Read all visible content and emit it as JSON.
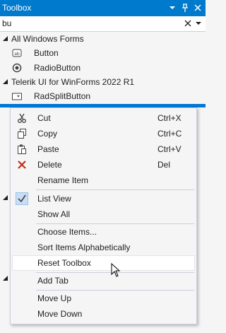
{
  "window": {
    "title": "Toolbox"
  },
  "search": {
    "value": "bu"
  },
  "tree": {
    "groups": [
      {
        "label": "All Windows Forms",
        "items": [
          "Button",
          "RadioButton"
        ]
      },
      {
        "label": "Telerik UI for WinForms 2022 R1",
        "items": [
          "RadSplitButton"
        ]
      }
    ]
  },
  "menu": {
    "items": [
      {
        "label": "Cut",
        "shortcut": "Ctrl+X",
        "icon": "scissors-icon"
      },
      {
        "label": "Copy",
        "shortcut": "Ctrl+C",
        "icon": "copy-icon"
      },
      {
        "label": "Paste",
        "shortcut": "Ctrl+V",
        "icon": "paste-icon"
      },
      {
        "label": "Delete",
        "shortcut": "Del",
        "icon": "delete-icon"
      },
      {
        "label": "Rename Item",
        "shortcut": ""
      },
      {
        "label": "List View",
        "shortcut": "",
        "checked": true
      },
      {
        "label": "Show All",
        "shortcut": ""
      },
      {
        "label": "Choose Items...",
        "shortcut": ""
      },
      {
        "label": "Sort Items Alphabetically",
        "shortcut": ""
      },
      {
        "label": "Reset Toolbox",
        "shortcut": "",
        "hovered": true
      },
      {
        "label": "Add Tab",
        "shortcut": ""
      },
      {
        "label": "Move Up",
        "shortcut": ""
      },
      {
        "label": "Move Down",
        "shortcut": ""
      }
    ]
  },
  "colors": {
    "accent": "#007ACC",
    "selection": "#0078D7",
    "delete": "#C42B1C"
  }
}
